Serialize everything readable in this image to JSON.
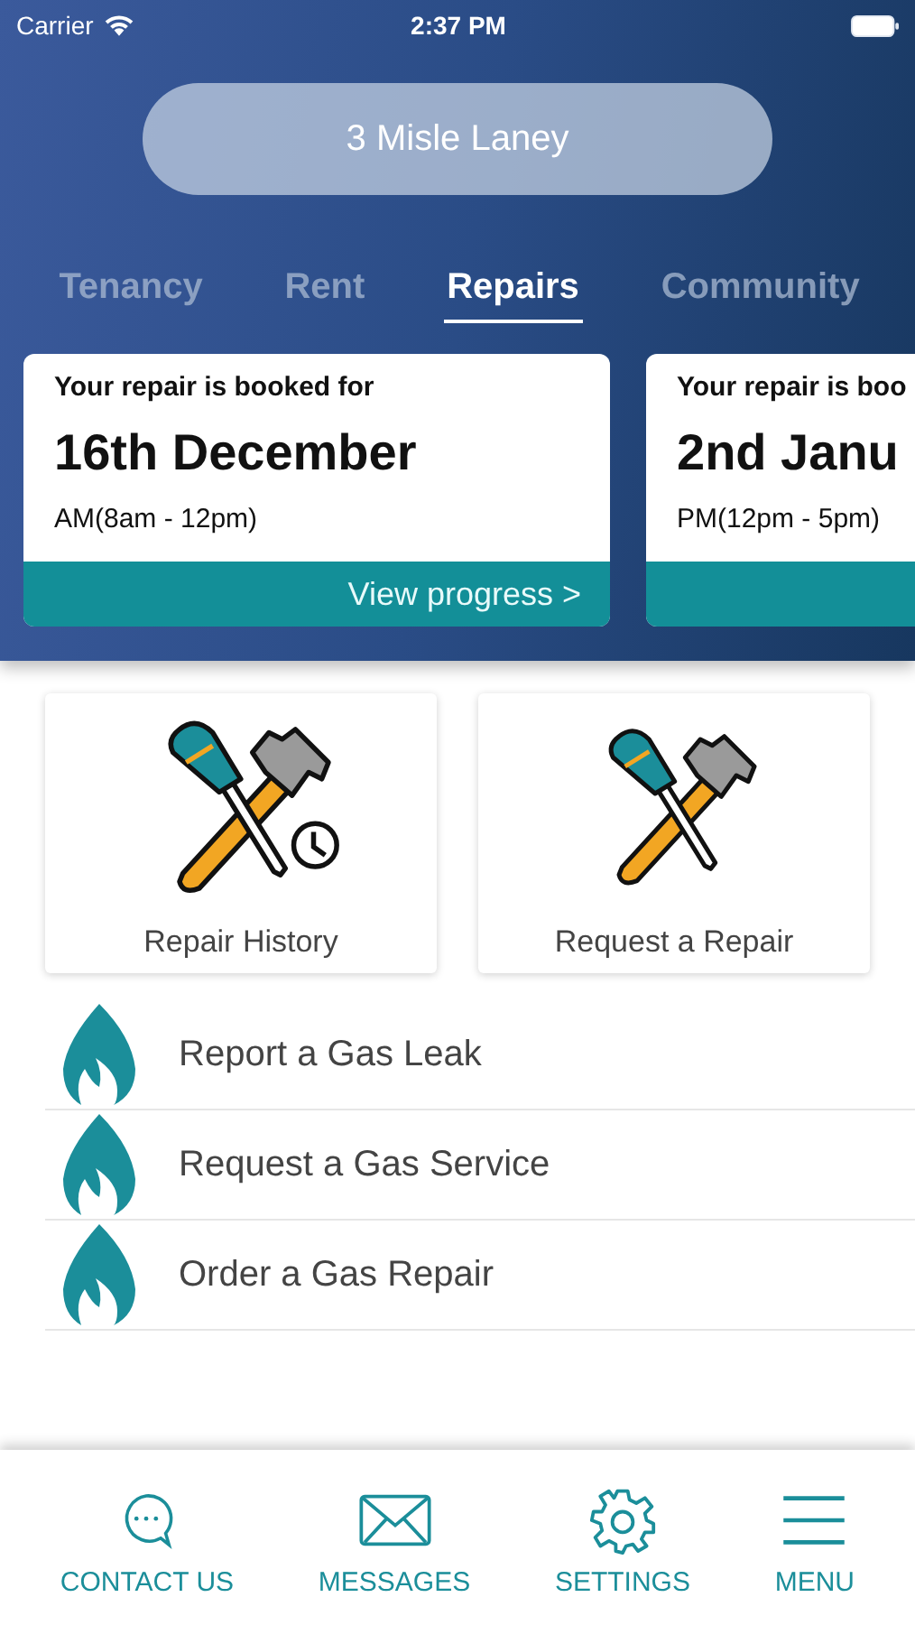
{
  "status_bar": {
    "carrier": "Carrier",
    "time": "2:37 PM"
  },
  "address": "3 Misle Laney",
  "tabs": [
    {
      "label": "Tenancy",
      "selected": false
    },
    {
      "label": "Rent",
      "selected": false
    },
    {
      "label": "Repairs",
      "selected": true
    },
    {
      "label": "Community",
      "selected": false
    }
  ],
  "bookings": [
    {
      "heading": "Your repair is booked for",
      "date": "16th December",
      "slot": "AM(8am - 12pm)",
      "link": "View progress >"
    },
    {
      "heading": "Your repair is boo",
      "date": "2nd Janu",
      "slot": "PM(12pm - 5pm)"
    }
  ],
  "tiles": [
    {
      "label": "Repair History",
      "clock": true
    },
    {
      "label": "Request a Repair",
      "clock": false
    }
  ],
  "gas_actions": [
    {
      "label": "Report a Gas Leak"
    },
    {
      "label": "Request a Gas Service"
    },
    {
      "label": "Order a Gas Repair"
    }
  ],
  "bottom_nav": [
    {
      "label": "CONTACT US",
      "kind": "chat"
    },
    {
      "label": "MESSAGES",
      "kind": "mail"
    },
    {
      "label": "SETTINGS",
      "kind": "gear"
    },
    {
      "label": "MENU",
      "kind": "menu"
    }
  ]
}
